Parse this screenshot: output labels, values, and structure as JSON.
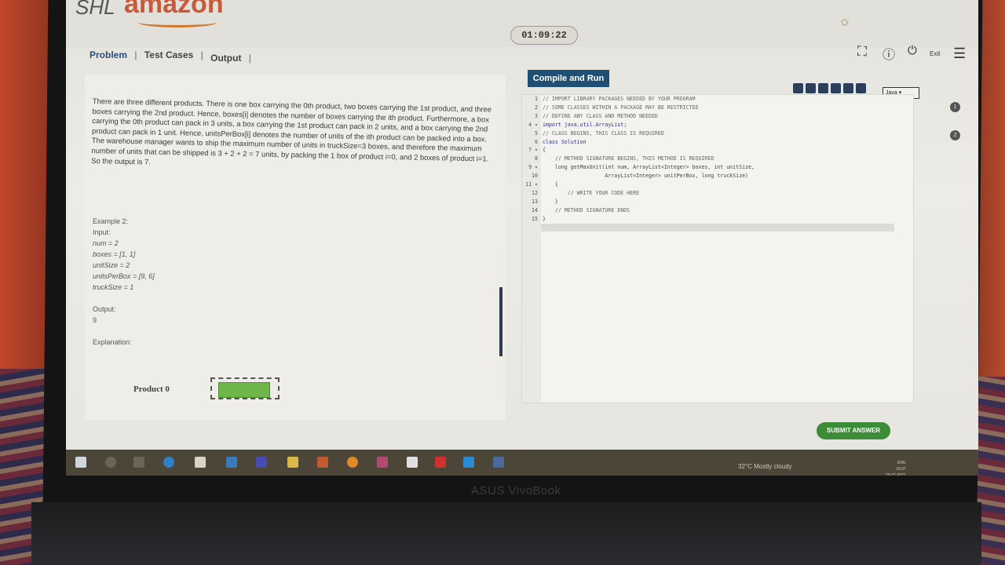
{
  "header": {
    "logo_shl": "SHL",
    "logo_amazon": "amazon",
    "timer": "01:09:22",
    "exit_label": "Exit"
  },
  "tabs": [
    {
      "label": "Problem",
      "active": true
    },
    {
      "label": "Test Cases",
      "active": false
    },
    {
      "label": "Output",
      "active": false
    }
  ],
  "compile_button": "Compile and Run",
  "problem": {
    "paragraphs": [
      "There are three different products. There is one box carrying the 0th product, two boxes carrying the 1st product, and three boxes carrying the 2nd product. Hence, boxes[i] denotes the number of boxes carrying the ith product. Furthermore, a box carrying the 0th product can pack in 3 units, a box carrying the 1st product can pack in 2 units, and a box carrying the 2nd product can pack in 1 unit. Hence, unitsPerBox[i] denotes the number of units of the ith product can be packed into a box.",
      "The warehouse manager wants to ship the maximum number of units in truckSize=3 boxes, and therefore the maximum number of units that can be shipped is 3 + 2 + 2 = 7 units, by packing the 1 box of product i=0, and 2 boxes of product i=1.",
      "So the output is 7."
    ],
    "example_title": "Example 2:",
    "input_label": "Input:",
    "inputs": [
      "num = 2",
      "boxes = [1, 1]",
      "unitSize = 2",
      "unitsPerBox = [9, 6]",
      "truckSize = 1"
    ],
    "output_label": "Output:",
    "output_value": "9",
    "explanation_label": "Explanation:",
    "figure_label": "Product 0"
  },
  "editor": {
    "language": "Java",
    "lines": [
      {
        "n": "1",
        "t": "// IMPORT LIBRARY PACKAGES NEEDED BY YOUR PROGRAM"
      },
      {
        "n": "2",
        "t": "// SOME CLASSES WITHIN A PACKAGE MAY BE RESTRICTED"
      },
      {
        "n": "3",
        "t": "// DEFINE ANY CLASS AND METHOD NEEDED"
      },
      {
        "n": "4 ▾",
        "t": "import java.util.ArrayList;"
      },
      {
        "n": "5",
        "t": "// CLASS BEGINS, THIS CLASS IS REQUIRED"
      },
      {
        "n": "6",
        "t": "class Solution"
      },
      {
        "n": "7 ▾",
        "t": "{"
      },
      {
        "n": "8",
        "t": "    // METHOD SIGNATURE BEGINS, THIS METHOD IS REQUIRED"
      },
      {
        "n": "9 ▾",
        "t": "    long getMaxUnit(int num, ArrayList<Integer> boxes, int unitSize,"
      },
      {
        "n": "10",
        "t": "                    ArrayList<Integer> unitPerBox, long truckSize)"
      },
      {
        "n": "11 ▾",
        "t": "    {"
      },
      {
        "n": "12",
        "t": "        // WRITE YOUR CODE HERE"
      },
      {
        "n": "13",
        "t": "    }"
      },
      {
        "n": "14",
        "t": "    // METHOD SIGNATURE ENDS"
      },
      {
        "n": "15",
        "t": "}"
      }
    ]
  },
  "side_buttons": [
    "1",
    "2"
  ],
  "submit_button": "SUBMIT ANSWER",
  "taskbar": {
    "weather": "32°C  Mostly cloudy",
    "lang": "ENG",
    "time": "16:07",
    "date": "25-07-2021"
  },
  "laptop_brand": "ASUS VivoBook"
}
